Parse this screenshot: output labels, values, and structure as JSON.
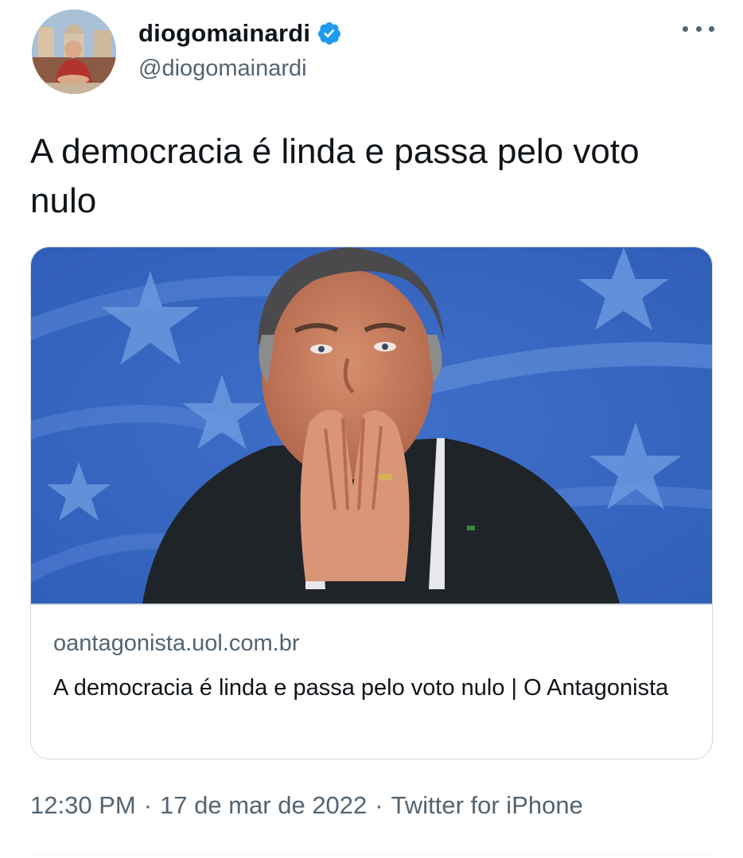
{
  "author": {
    "display_name": "diogomainardi",
    "handle": "@diogomainardi",
    "verified": true
  },
  "tweet": {
    "text": "A democracia é linda e passa pelo voto nulo"
  },
  "link_card": {
    "domain": "oantagonista.uol.com.br",
    "title": "A democracia é linda e passa pelo voto nulo | O Antagonista"
  },
  "meta": {
    "time": "12:30 PM",
    "separator": "·",
    "date": "17 de mar de 2022",
    "source": "Twitter for iPhone"
  },
  "icons": {
    "verified": "verified-badge-icon",
    "more": "more-options-icon"
  },
  "colors": {
    "verified_blue": "#1d9bf0",
    "secondary_text": "#536471",
    "primary_text": "#0f1419",
    "card_border": "#cfd9de"
  }
}
